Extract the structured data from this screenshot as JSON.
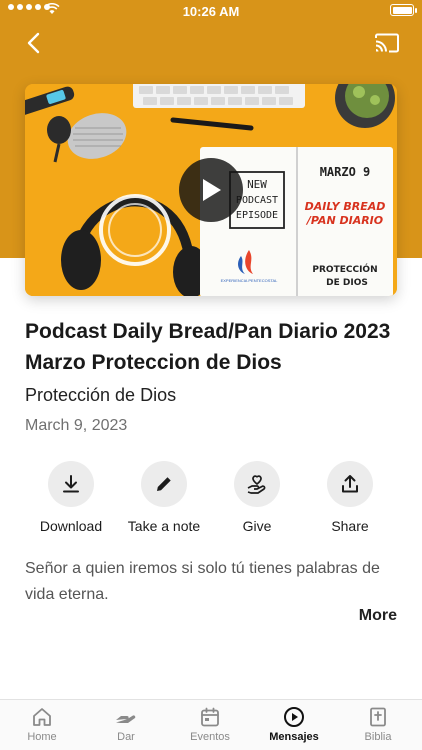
{
  "status_bar": {
    "time": "10:26 AM"
  },
  "episode": {
    "title": "Podcast Daily Bread/Pan Diario 2023 Marzo Proteccion de Dios",
    "subtitle": "Protección de Dios",
    "date": "March 9, 2023",
    "description": "Señor a quien iremos si solo tú tienes palabras de vida eterna.",
    "more_label": "More"
  },
  "thumbnail": {
    "notebook_left_text": "NEW PODCAST EPISODE",
    "notebook_right_date": "MARZO 9",
    "notebook_right_title": "DAILY BREAD /PAN DIARIO",
    "notebook_right_subject": "PROTECCIÓN DE DIOS",
    "logo_text": "EXPERIENCIA PENTECOSTAL"
  },
  "actions": [
    {
      "label": "Download",
      "icon": "download-icon"
    },
    {
      "label": "Take a note",
      "icon": "pencil-icon"
    },
    {
      "label": "Give",
      "icon": "hand-heart-icon"
    },
    {
      "label": "Share",
      "icon": "share-icon"
    }
  ],
  "tabs": [
    {
      "label": "Home",
      "icon": "home-icon",
      "active": false
    },
    {
      "label": "Dar",
      "icon": "hand-icon",
      "active": false
    },
    {
      "label": "Eventos",
      "icon": "calendar-icon",
      "active": false
    },
    {
      "label": "Mensajes",
      "icon": "play-circle-icon",
      "active": true
    },
    {
      "label": "Biblia",
      "icon": "bible-icon",
      "active": false
    }
  ],
  "colors": {
    "hero_band": "#d89419",
    "thumbnail_background": "#f4a818",
    "active_tab": "#111111",
    "inactive_tab": "#8a8a8a"
  }
}
